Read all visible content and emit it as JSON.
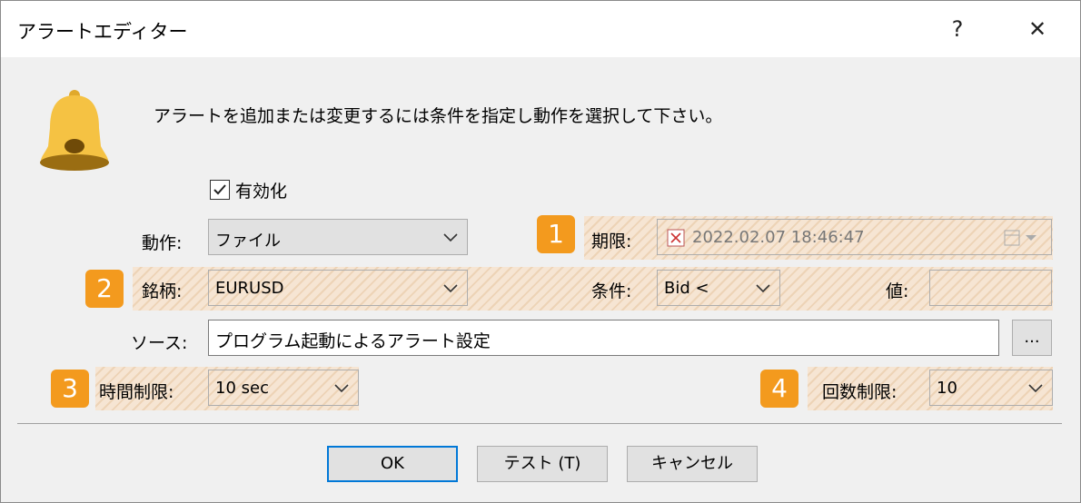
{
  "window": {
    "title": "アラートエディター",
    "help": "?",
    "close": "✕"
  },
  "message": "アラートを追加または変更するには条件を指定し動作を選択して下さい。",
  "enable": {
    "label": "有効化",
    "checked": true
  },
  "action": {
    "label": "動作:",
    "value": "ファイル"
  },
  "expiry": {
    "label": "期限:",
    "value": "2022.02.07 18:46:47"
  },
  "symbol": {
    "label": "銘柄:",
    "value": "EURUSD"
  },
  "condition": {
    "label": "条件:",
    "value": "Bid <"
  },
  "value_field": {
    "label": "値:",
    "value": ""
  },
  "source": {
    "label": "ソース:",
    "value": "プログラム起動によるアラート設定",
    "browse": "..."
  },
  "time_limit": {
    "label": "時間制限:",
    "value": "10 sec"
  },
  "count_limit": {
    "label": "回数制限:",
    "value": "10"
  },
  "badges": [
    "1",
    "2",
    "3",
    "4"
  ],
  "buttons": {
    "ok": "OK",
    "test": "テスト (T)",
    "cancel": "キャンセル"
  },
  "colors": {
    "badge": "#f39a1e",
    "highlight": "#f6e5d3",
    "focus": "#0078d7",
    "bell": "#f5c243"
  }
}
